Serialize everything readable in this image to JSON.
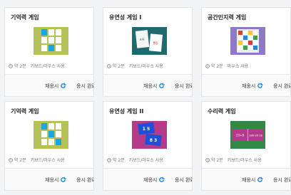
{
  "cards": [
    {
      "title": "기억력 게임",
      "time": "약 2분",
      "control": "키보드/마우스 사용",
      "replay": "재응시",
      "done": "응시 완료",
      "thumb_icon": "memory-grid-icon"
    },
    {
      "title": "유연성 게임 I",
      "time": "약 2분",
      "control": "키보드/마우스 사용",
      "replay": "재응시",
      "done": "응시 완료",
      "thumb_icon": "flexibility-cards-icon"
    },
    {
      "title": "공간인지력 게임",
      "time": "약 2분",
      "control": "마우스 사용",
      "replay": "재응시",
      "done": "응시 완료",
      "thumb_icon": "spatial-board-icon"
    },
    {
      "title": "기억력 게임",
      "time": "약 2분",
      "control": "키보드/마우스 사용",
      "replay": "재응시",
      "done": "응시 완료",
      "thumb_icon": "memory-grid-icon"
    },
    {
      "title": "유연성 게임 II",
      "time": "약 2분",
      "control": "키보드/마우스 사용",
      "replay": "재응시",
      "done": "응시 완료",
      "thumb_icon": "number-cards-icon"
    },
    {
      "title": "수리력 게임",
      "time": "약 2분",
      "control": "키보드/마우스 사용",
      "replay": "재응시",
      "done": "응시 완료",
      "thumb_icon": "math-cards-icon"
    }
  ],
  "thumbs": {
    "flex1_word_a": "초록",
    "flex1_word_b": "빨강",
    "flex2_top": "1 5",
    "flex2_bottom": "8 3",
    "math_left": "23+8",
    "math_right": "189-26-18"
  },
  "colors": {
    "accent_blue": "#1e88e5",
    "check_red": "#e53935",
    "memory_bg": "#b5c25a",
    "memory_tile_blue": "#18a7e3",
    "flex1_bg": "#1f6a6e",
    "spatial_bg": "#8d78c9",
    "flex2_bg": "#b53b8a",
    "math_bg": "#2f8a46"
  }
}
